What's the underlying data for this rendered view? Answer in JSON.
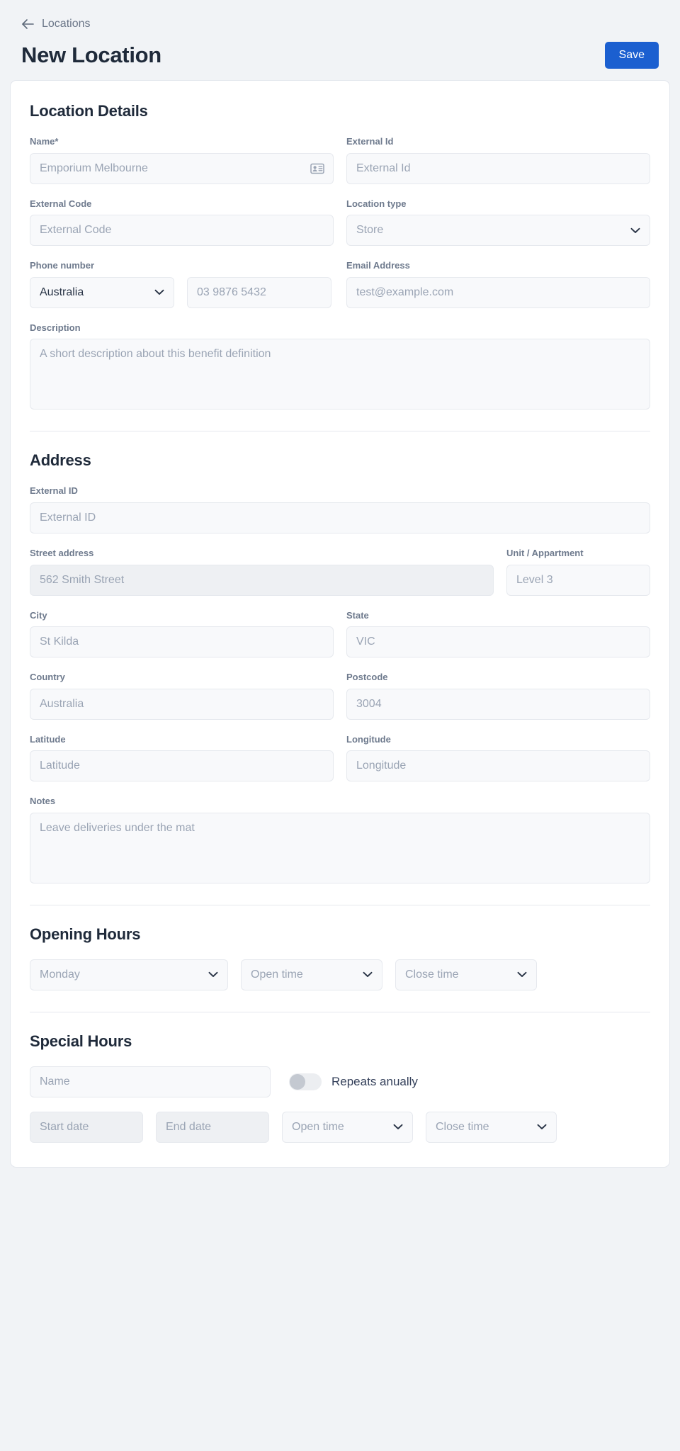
{
  "header": {
    "breadcrumb_label": "Locations",
    "back_icon": "arrow-left-icon",
    "page_title": "New Location",
    "save_label": "Save",
    "accent_color": "#1b5fd0"
  },
  "location_details": {
    "section_title": "Location Details",
    "name": {
      "label": "Name",
      "required_mark": "*",
      "placeholder": "Emporium Melbourne",
      "trailing_icon": "contact-card-icon"
    },
    "external_id": {
      "label": "External Id",
      "placeholder": "External Id"
    },
    "external_code": {
      "label": "External Code",
      "placeholder": "External Code"
    },
    "location_type": {
      "label": "Location type",
      "value": "Store",
      "chevron_icon": "chevron-down-icon"
    },
    "phone": {
      "label": "Phone number",
      "country_value": "Australia",
      "country_chevron_icon": "chevron-down-icon",
      "number_placeholder": "03 9876 5432"
    },
    "email": {
      "label": "Email Address",
      "placeholder": "test@example.com"
    },
    "description": {
      "label": "Description",
      "placeholder": "A short description about this benefit definition"
    }
  },
  "address": {
    "section_title": "Address",
    "external_id": {
      "label": "External ID",
      "placeholder": "External ID"
    },
    "street": {
      "label": "Street address",
      "placeholder": "562 Smith Street"
    },
    "unit": {
      "label": "Unit / Appartment",
      "placeholder": "Level 3"
    },
    "city": {
      "label": "City",
      "placeholder": "St Kilda"
    },
    "state": {
      "label": "State",
      "placeholder": "VIC"
    },
    "country": {
      "label": "Country",
      "placeholder": "Australia"
    },
    "postcode": {
      "label": "Postcode",
      "placeholder": "3004"
    },
    "latitude": {
      "label": "Latitude",
      "placeholder": "Latitude"
    },
    "longitude": {
      "label": "Longitude",
      "placeholder": "Longitude"
    },
    "notes": {
      "label": "Notes",
      "placeholder": "Leave deliveries under the mat"
    }
  },
  "opening_hours": {
    "section_title": "Opening Hours",
    "day": {
      "value": "Monday",
      "chevron_icon": "chevron-down-icon"
    },
    "open_time": {
      "value": "Open time",
      "chevron_icon": "chevron-down-icon"
    },
    "close_time": {
      "value": "Close time",
      "chevron_icon": "chevron-down-icon"
    }
  },
  "special_hours": {
    "section_title": "Special Hours",
    "name": {
      "placeholder": "Name"
    },
    "repeats_toggle": {
      "label": "Repeats anually",
      "checked": false
    },
    "start_date": {
      "placeholder": "Start date"
    },
    "end_date": {
      "placeholder": "End date"
    },
    "open_time": {
      "value": "Open time",
      "chevron_icon": "chevron-down-icon"
    },
    "close_time": {
      "value": "Close time",
      "chevron_icon": "chevron-down-icon"
    }
  }
}
